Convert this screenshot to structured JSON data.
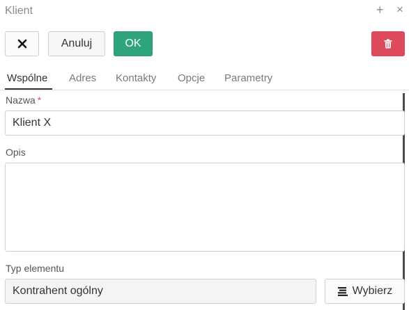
{
  "window": {
    "title": "Klient",
    "plus_glyph": "+",
    "close_glyph": "×"
  },
  "toolbar": {
    "close_glyph": "✕",
    "cancel_label": "Anuluj",
    "ok_label": "OK",
    "ok_color": "#2ea37c",
    "delete_color": "#dc4a5c"
  },
  "tabs": [
    {
      "label": "Wspólne",
      "active": true
    },
    {
      "label": "Adres",
      "active": false
    },
    {
      "label": "Kontakty",
      "active": false
    },
    {
      "label": "Opcje",
      "active": false
    },
    {
      "label": "Parametry",
      "active": false
    }
  ],
  "form": {
    "name": {
      "label": "Nazwa",
      "required_mark": "*",
      "value": "Klient X"
    },
    "description": {
      "label": "Opis",
      "value": ""
    },
    "element_type": {
      "label": "Typ elementu",
      "value": "Kontrahent ogólny",
      "choose_label": "Wybierz"
    }
  },
  "icons": {
    "close": "x-icon",
    "delete": "trash-icon",
    "choose": "list-icon"
  }
}
